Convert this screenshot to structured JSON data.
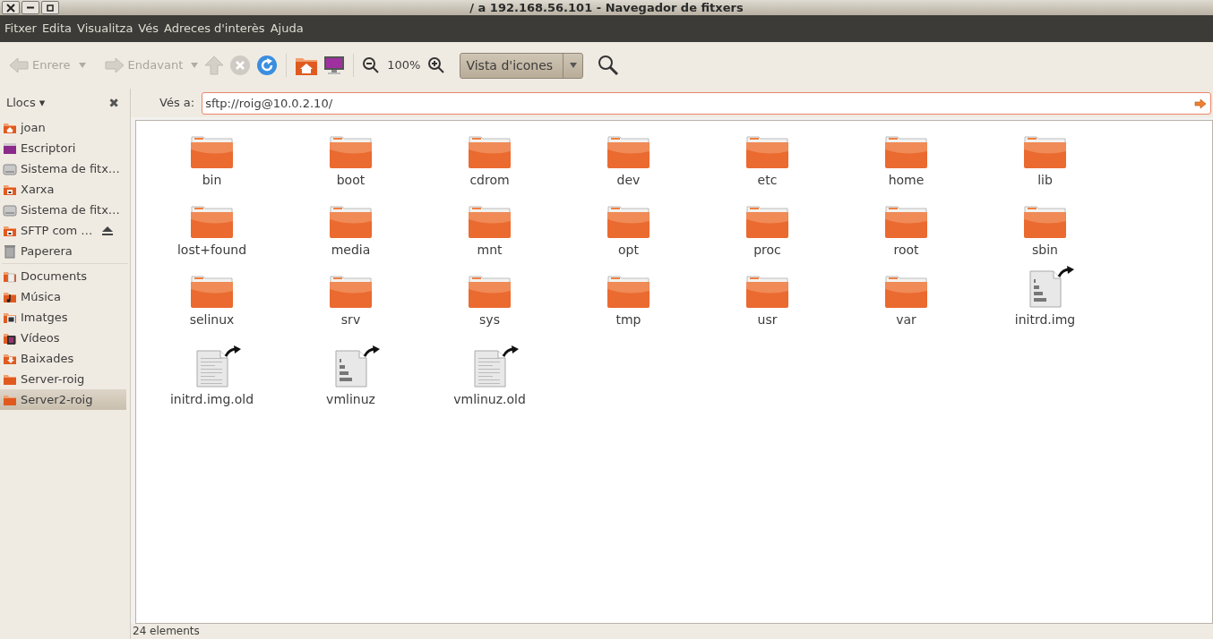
{
  "window": {
    "title": "/ a 192.168.56.101 - Navegador de fitxers"
  },
  "menu": [
    "Fitxer",
    "Edita",
    "Visualitza",
    "Vés",
    "Adreces d'interès",
    "Ajuda"
  ],
  "toolbar": {
    "back": {
      "label": "Enrere",
      "disabled": true
    },
    "forward": {
      "label": "Endavant",
      "disabled": true
    },
    "up": {
      "disabled": true
    },
    "stop": {
      "disabled": true
    },
    "reload": {
      "disabled": false
    },
    "zoom": "100%",
    "view": "Vista d'icones"
  },
  "sidebar": {
    "title": "Llocs ▾",
    "close": "✖",
    "sections": [
      [
        {
          "label": "joan",
          "kind": "home",
          "ejectable": false,
          "selected": false
        },
        {
          "label": "Escriptori",
          "kind": "desktop",
          "ejectable": false,
          "selected": false
        },
        {
          "label": "Sistema de fitx…",
          "kind": "drive",
          "ejectable": false,
          "selected": false
        },
        {
          "label": "Xarxa",
          "kind": "network",
          "ejectable": false,
          "selected": false
        },
        {
          "label": "Sistema de fitx…",
          "kind": "drive",
          "ejectable": false,
          "selected": false
        },
        {
          "label": "SFTP com …",
          "kind": "network",
          "ejectable": true,
          "selected": false
        },
        {
          "label": "Paperera",
          "kind": "trash",
          "ejectable": false,
          "selected": false
        }
      ],
      [
        {
          "label": "Documents",
          "kind": "documents",
          "ejectable": false,
          "selected": false
        },
        {
          "label": "Música",
          "kind": "music",
          "ejectable": false,
          "selected": false
        },
        {
          "label": "Imatges",
          "kind": "pictures",
          "ejectable": false,
          "selected": false
        },
        {
          "label": "Vídeos",
          "kind": "videos",
          "ejectable": false,
          "selected": false
        },
        {
          "label": "Baixades",
          "kind": "downloads",
          "ejectable": false,
          "selected": false
        },
        {
          "label": "Server-roig",
          "kind": "folder",
          "ejectable": false,
          "selected": false
        },
        {
          "label": "Server2-roig",
          "kind": "folder",
          "ejectable": false,
          "selected": true
        }
      ]
    ]
  },
  "location": {
    "label": "Vés a:",
    "value": "sftp://roig@10.0.2.10/"
  },
  "files": [
    {
      "name": "bin",
      "kind": "folder",
      "symlink": false
    },
    {
      "name": "boot",
      "kind": "folder",
      "symlink": false
    },
    {
      "name": "cdrom",
      "kind": "folder",
      "symlink": false
    },
    {
      "name": "dev",
      "kind": "folder",
      "symlink": false
    },
    {
      "name": "etc",
      "kind": "folder",
      "symlink": false
    },
    {
      "name": "home",
      "kind": "folder",
      "symlink": false
    },
    {
      "name": "lib",
      "kind": "folder",
      "symlink": false
    },
    {
      "name": "lost+found",
      "kind": "folder",
      "symlink": false
    },
    {
      "name": "media",
      "kind": "folder",
      "symlink": false
    },
    {
      "name": "mnt",
      "kind": "folder",
      "symlink": false
    },
    {
      "name": "opt",
      "kind": "folder",
      "symlink": false
    },
    {
      "name": "proc",
      "kind": "folder",
      "symlink": false
    },
    {
      "name": "root",
      "kind": "folder",
      "symlink": false
    },
    {
      "name": "sbin",
      "kind": "folder",
      "symlink": false
    },
    {
      "name": "selinux",
      "kind": "folder",
      "symlink": false
    },
    {
      "name": "srv",
      "kind": "folder",
      "symlink": false
    },
    {
      "name": "sys",
      "kind": "folder",
      "symlink": false
    },
    {
      "name": "tmp",
      "kind": "folder",
      "symlink": false
    },
    {
      "name": "usr",
      "kind": "folder",
      "symlink": false
    },
    {
      "name": "var",
      "kind": "folder",
      "symlink": false
    },
    {
      "name": "initrd.img",
      "kind": "binary",
      "symlink": true
    },
    {
      "name": "initrd.img.old",
      "kind": "text",
      "symlink": true
    },
    {
      "name": "vmlinuz",
      "kind": "binary",
      "symlink": true
    },
    {
      "name": "vmlinuz.old",
      "kind": "text",
      "symlink": true
    }
  ],
  "status_bar": "24 elements"
}
